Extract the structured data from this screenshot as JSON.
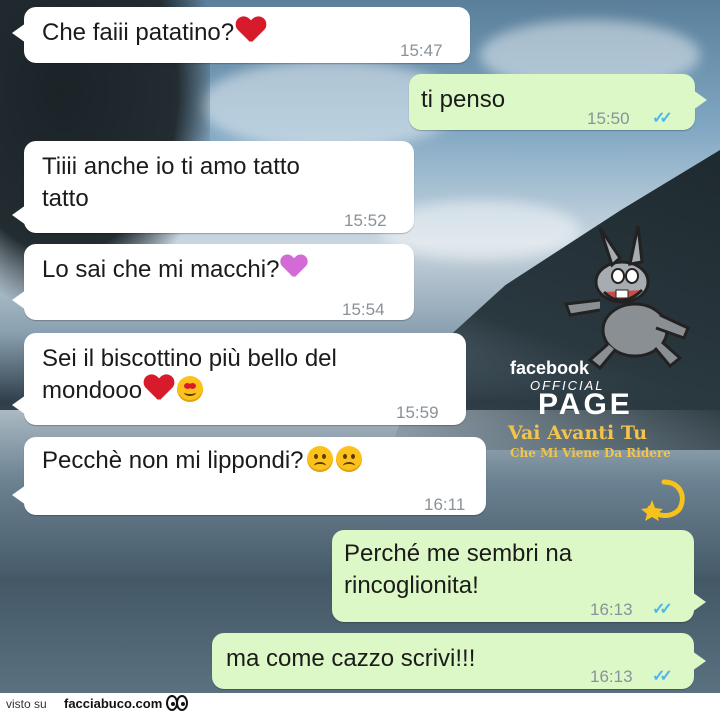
{
  "messages": [
    {
      "direction": "in",
      "text": "Che faiii patatino?",
      "emoji": [
        "red-heart"
      ],
      "time": "15:47"
    },
    {
      "direction": "out",
      "text": "ti penso",
      "time": "15:50",
      "read": true
    },
    {
      "direction": "in",
      "text_line1": "Tiiii anche io ti amo tatto",
      "text_line2": "tatto",
      "time": "15:52"
    },
    {
      "direction": "in",
      "text": "Lo sai che mi macchi?",
      "emoji": [
        "two-hearts"
      ],
      "time": "15:54"
    },
    {
      "direction": "in",
      "text_line1": "Sei il biscottino più bello del",
      "text_line2": "mondooo",
      "emoji": [
        "red-heart",
        "heart-eyes"
      ],
      "time": "15:59"
    },
    {
      "direction": "in",
      "text": "Pecchè non mi lippondi?",
      "emoji": [
        "frowning-face",
        "frowning-face"
      ],
      "time": "16:11"
    },
    {
      "direction": "out",
      "text_line1": "Perché me sembri na",
      "text_line2": "rincoglionita!",
      "time": "16:13",
      "read": true
    },
    {
      "direction": "out",
      "text": "ma come cazzo scrivi!!!",
      "time": "16:13",
      "read": true
    }
  ],
  "watermark": {
    "brand": "facebook",
    "official": "OFFICIAL",
    "page": "PAGE",
    "tagline1": "Vai Avanti Tu",
    "tagline2": "Che Mi Viene Da Ridere"
  },
  "footer": {
    "visto": "visto su",
    "site": "facciabuco.com"
  },
  "colors": {
    "incoming": "#ffffff",
    "outgoing": "#dcf8c6",
    "tick": "#4fb6ec",
    "timestamp": "#8a9299"
  }
}
